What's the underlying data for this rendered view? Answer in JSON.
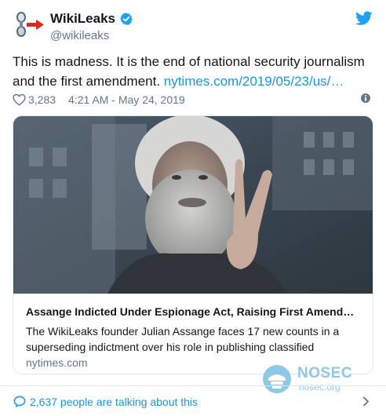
{
  "account": {
    "name": "WikiLeaks",
    "handle": "@wikileaks"
  },
  "tweet": {
    "text": "This is madness. It is the end of national security journalism and the first amendment.",
    "link": "nytimes.com/2019/05/23/us/…",
    "likes": "3,283",
    "timestamp": "4:21 AM - May 24, 2019"
  },
  "card": {
    "title": "Assange Indicted Under Espionage Act, Raising First Amend…",
    "description": "The WikiLeaks founder Julian Assange faces 17 new counts in a superseding indictment over his role in publishing classified",
    "domain": "nytimes.com"
  },
  "footer": {
    "talking": "2,637 people are talking about this"
  },
  "watermark": {
    "title": "NOSEC",
    "subtitle": "nosec.org"
  },
  "colors": {
    "link": "#1b95e0",
    "secondary_text": "#657786",
    "verified": "#1da1f2",
    "border": "#e1e8ed"
  },
  "icons": {
    "verified": "verified-badge-icon",
    "bird": "twitter-bird-icon",
    "heart": "heart-icon",
    "info": "info-icon",
    "reply": "speech-bubble-icon",
    "chevron": "chevron-right-icon"
  }
}
